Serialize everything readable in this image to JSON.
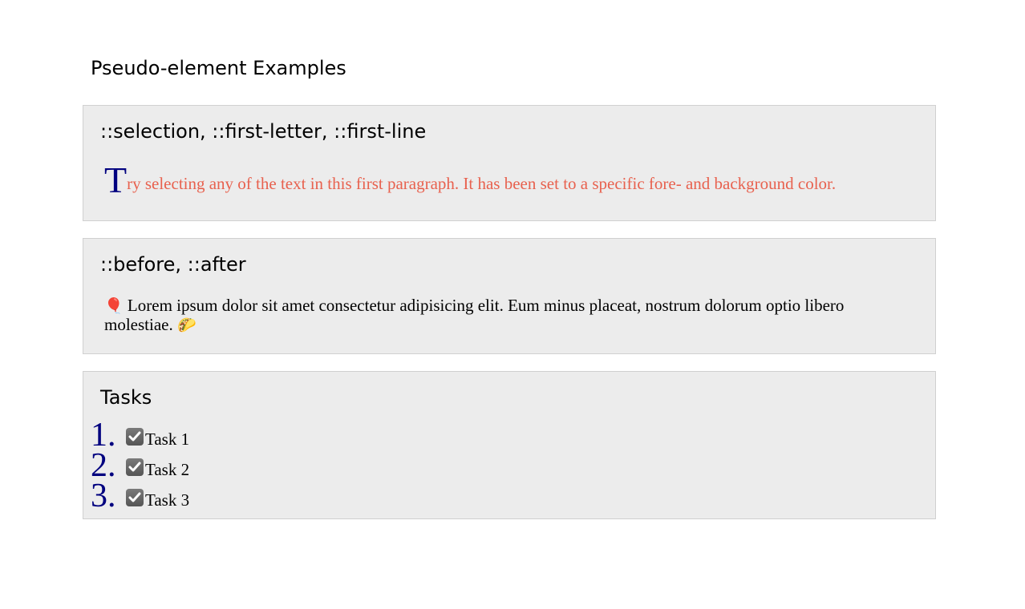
{
  "page": {
    "title": "Pseudo-element Examples"
  },
  "sections": {
    "selection": {
      "heading": "::selection, ::first-letter, ::first-line",
      "first_letter": "T",
      "paragraph_rest": "ry selecting any of the text in this first paragraph. It has been set to a specific fore- and background color.",
      "text_color": "#e8614e",
      "first_letter_color": "#00007f"
    },
    "before_after": {
      "heading": "::before, ::after",
      "before_icon": "balloon-icon",
      "before_glyph": "🎈",
      "paragraph": "Lorem ipsum dolor sit amet consectetur adipisicing elit. Eum minus placeat, nostrum dolorum optio libero molestiae.",
      "after_icon": "taco-icon",
      "after_glyph": "🌮"
    },
    "tasks": {
      "heading": "Tasks",
      "number_color": "#00007f",
      "items": [
        {
          "number": "1.",
          "label": "Task 1",
          "checked": true
        },
        {
          "number": "2.",
          "label": "Task 2",
          "checked": true
        },
        {
          "number": "3.",
          "label": "Task 3",
          "checked": true
        }
      ]
    }
  }
}
